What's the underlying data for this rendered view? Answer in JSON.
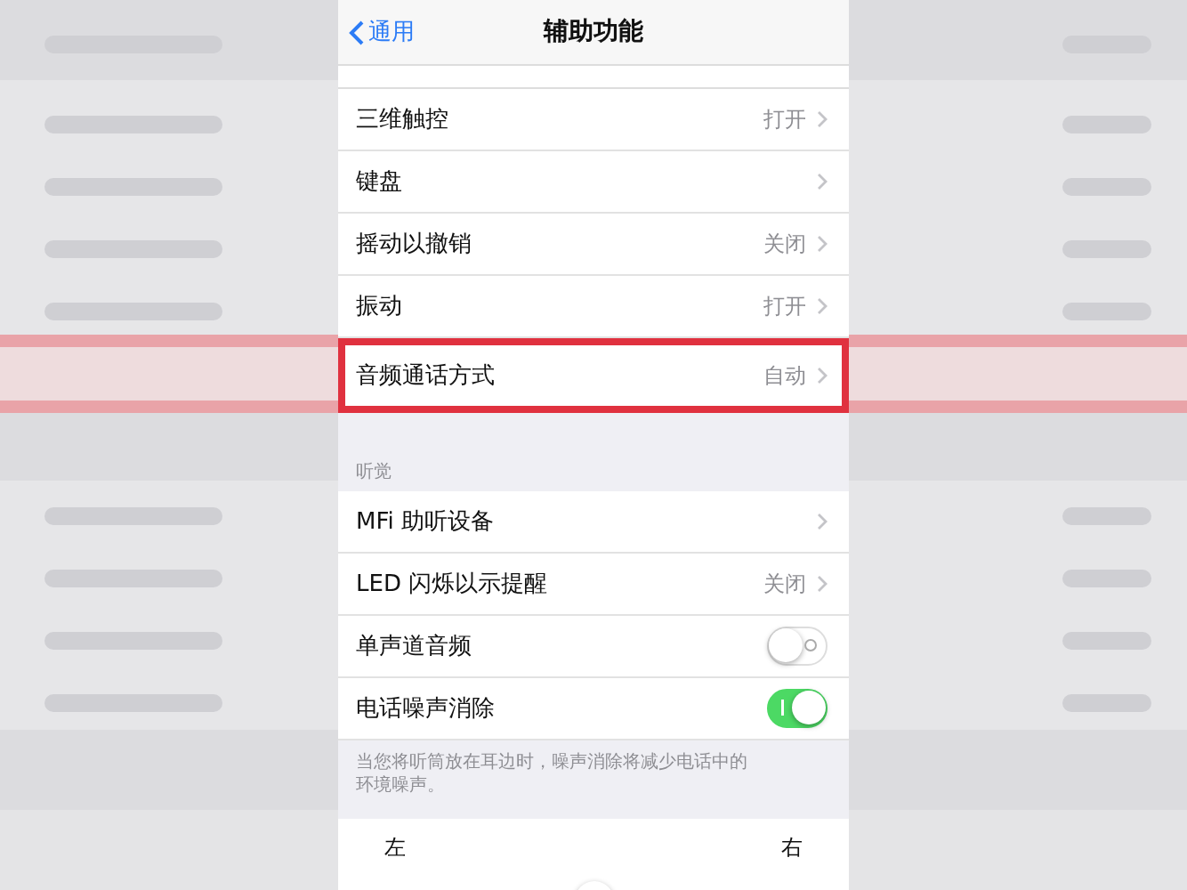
{
  "nav": {
    "back": "通用",
    "title": "辅助功能"
  },
  "rows": [
    {
      "kind": "link",
      "label": "三维触控",
      "value": "打开",
      "highlighted": false
    },
    {
      "kind": "link",
      "label": "键盘",
      "highlighted": false
    },
    {
      "kind": "link",
      "label": "摇动以撤销",
      "value": "关闭",
      "highlighted": false
    },
    {
      "kind": "link",
      "label": "振动",
      "value": "打开",
      "highlighted": false
    },
    {
      "kind": "link",
      "label": "音频通话方式",
      "value": "自动",
      "highlighted": true
    }
  ],
  "hearing": {
    "header": "听觉",
    "rows": [
      {
        "kind": "link",
        "label": "MFi 助听设备"
      },
      {
        "kind": "link",
        "label": "LED 闪烁以示提醒",
        "value": "关闭"
      },
      {
        "kind": "toggle",
        "label": "单声道音频",
        "on": false
      },
      {
        "kind": "toggle",
        "label": "电话噪声消除",
        "on": true
      }
    ],
    "footer": "当您将听筒放在耳边时，噪声消除将减少电话中的环境噪声。"
  },
  "balance": {
    "left": "左",
    "right": "右",
    "level": 0.5
  }
}
